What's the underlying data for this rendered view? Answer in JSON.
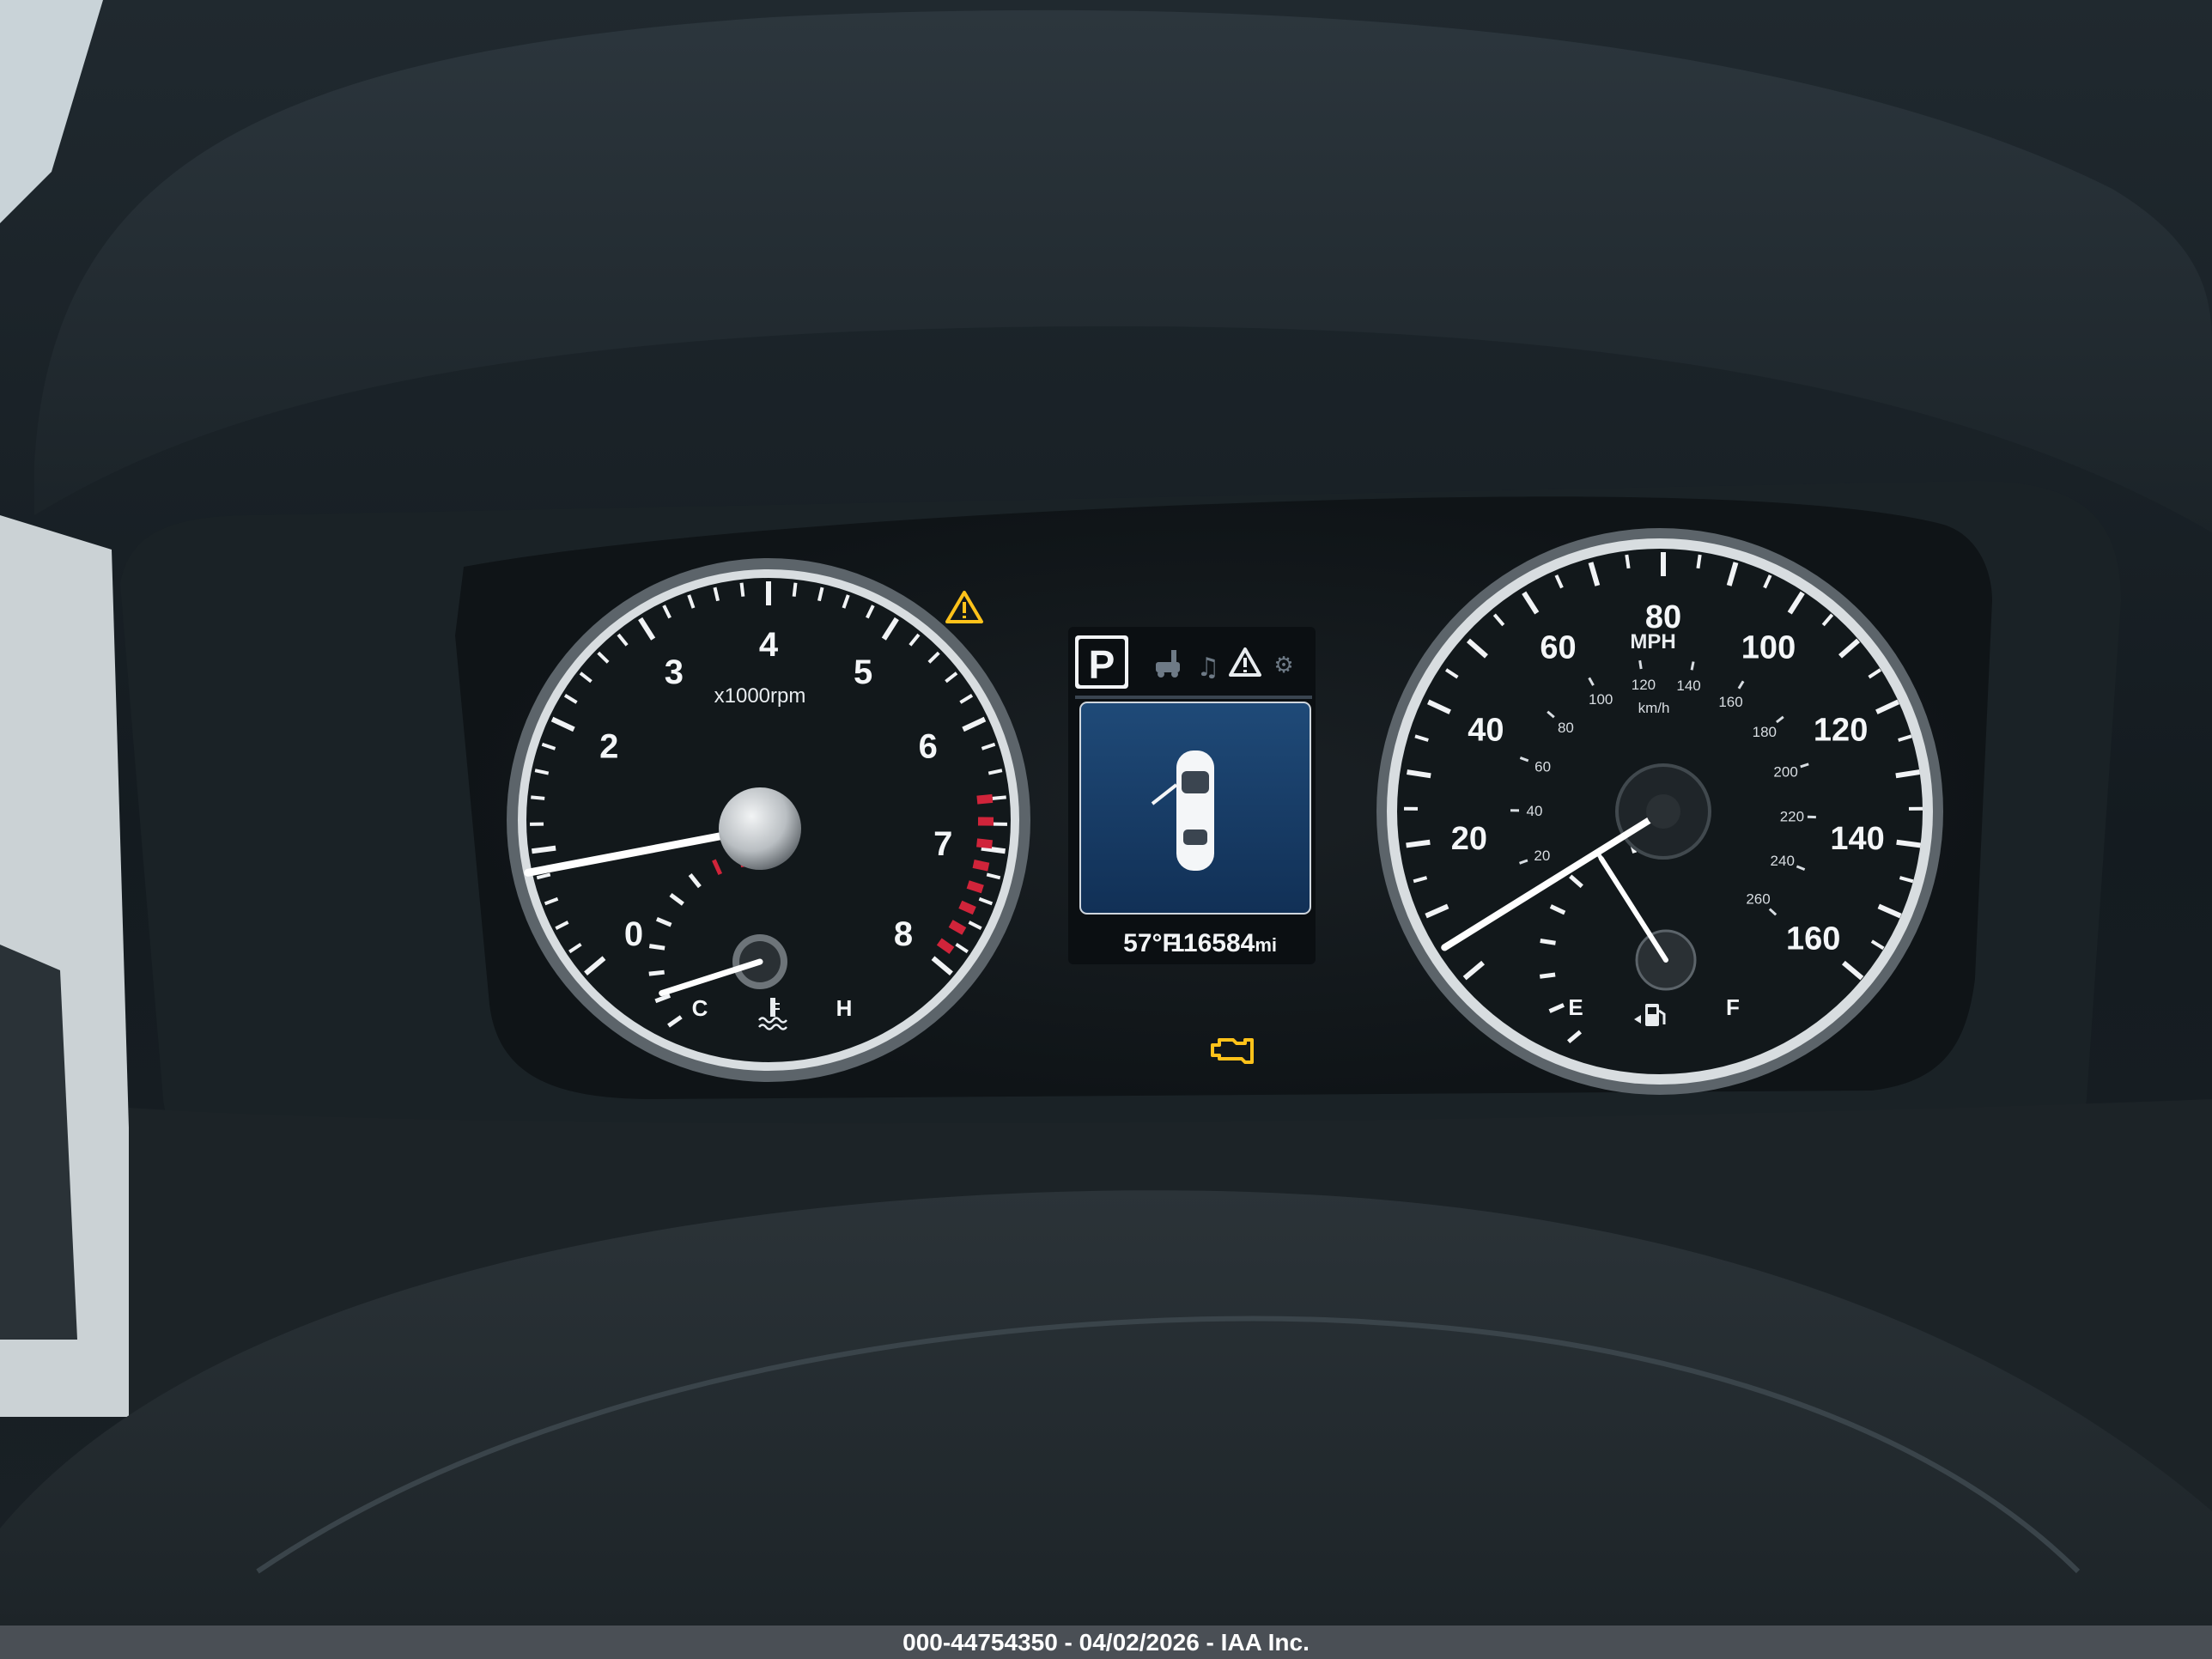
{
  "tachometer": {
    "unit_label": "x1000rpm",
    "scale_labels": [
      "0",
      "1",
      "2",
      "3",
      "4",
      "5",
      "6",
      "7",
      "8"
    ],
    "reading_rpm_x1000": 0.9,
    "temp_labels": {
      "cold": "C",
      "hot": "H"
    },
    "temp_level": 0.15
  },
  "speedometer": {
    "unit_label": "MPH",
    "mph_labels": [
      "0",
      "20",
      "40",
      "60",
      "80",
      "100",
      "120",
      "140",
      "160"
    ],
    "kmh_unit": "km/h",
    "kmh_labels": [
      "20",
      "40",
      "60",
      "80",
      "100",
      "120",
      "140",
      "160",
      "180",
      "200",
      "220",
      "240",
      "260"
    ],
    "reading_mph": 5,
    "fuel_labels": {
      "empty": "E",
      "full": "F"
    },
    "fuel_level": 0.75
  },
  "center_display": {
    "gear": "P",
    "temperature": "57°F",
    "odometer_value": "116584",
    "odometer_unit": "mi",
    "mode_icons": [
      "car-lift-icon",
      "music-note-icon",
      "warning-triangle-icon",
      "gear-settings-icon"
    ]
  },
  "warning_lights": [
    "master-warning-icon",
    "check-engine-icon"
  ],
  "colors": {
    "warning_amber": "#ffc21a",
    "redline": "#d0243a",
    "needle": "#ffffff",
    "display_blue": "#2a5a8f"
  },
  "caption": "000-44754350 - 04/02/2026 - IAA Inc."
}
